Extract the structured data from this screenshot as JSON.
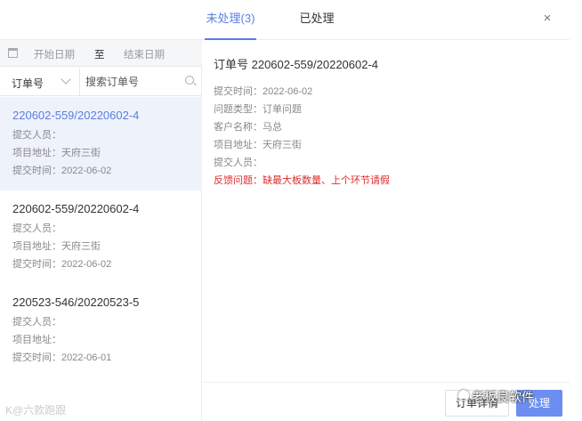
{
  "tabs": {
    "unprocessed": "未处理(3)",
    "processed": "已处理"
  },
  "close_label": "×",
  "filter": {
    "date_start_placeholder": "开始日期",
    "date_separator": "至",
    "date_end_placeholder": "结束日期",
    "select_value": "订单号",
    "search_placeholder": "搜索订单号"
  },
  "orders": [
    {
      "order_no": "220602-559/20220602-4",
      "submitter": "提交人员：",
      "address": "项目地址：天府三街",
      "time": "提交时间：2022-06-02"
    },
    {
      "order_no": "220602-559/20220602-4",
      "submitter": "提交人员：",
      "address": "项目地址：天府三街",
      "time": "提交时间：2022-06-02"
    },
    {
      "order_no": "220523-546/20220523-5",
      "submitter": "提交人员：",
      "address": "项目地址：",
      "time": "提交时间：2022-06-01"
    }
  ],
  "detail": {
    "title": "订单号 220602-559/20220602-4",
    "submit_time": "提交时间：2022-06-02",
    "issue_type": "问题类型：订单问题",
    "customer": "客户名称：马总",
    "address": "项目地址：天府三街",
    "submitter": "提交人员：",
    "feedback": "反馈问题：缺最大板数量、上个环节请假"
  },
  "footer": {
    "order_detail_button": "订单详情",
    "primary_button": "处理"
  },
  "watermarks": {
    "left": "K@六款跑跟",
    "right": "老板良软件"
  },
  "colors": {
    "accent": "#5b7fe0",
    "warning": "#e02b2b"
  }
}
